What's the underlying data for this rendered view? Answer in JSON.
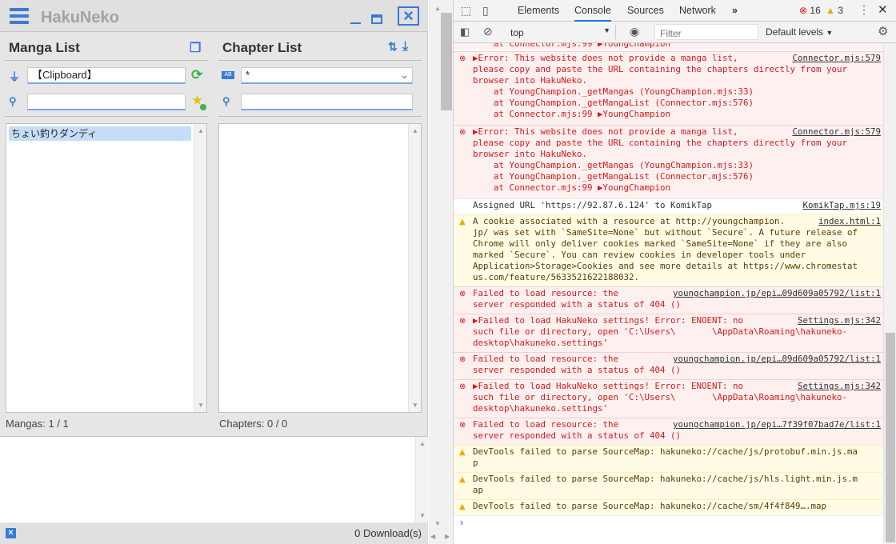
{
  "app": {
    "title": "HakuNeko",
    "manga_list_title": "Manga List",
    "chapter_list_title": "Chapter List",
    "connector_value": "【Clipboard】",
    "language_value": "*",
    "search_value": "",
    "chapter_search_value": "",
    "manga_items": [
      "ちょい釣りダンディ"
    ],
    "manga_count": "Mangas: 1 / 1",
    "chapter_count": "Chapters: 0 / 0",
    "downloads": "0 Download(s)",
    "lang_badge": "AB"
  },
  "devtools": {
    "tabs": [
      "Elements",
      "Console",
      "Sources",
      "Network"
    ],
    "more": "»",
    "errors": "16",
    "warnings": "3",
    "context": "top",
    "filter_placeholder": "Filter",
    "levels": "Default levels",
    "prompt": "›",
    "truncated": "    at Connector.mjs:99 ▶YoungChampion",
    "messages": [
      {
        "type": "err",
        "lines": "▶Error: This website does not provide a manga list,\nplease copy and paste the URL containing the chapters directly from your\nbrowser into HakuNeko.\n    at YoungChampion._getMangas (YoungChampion.mjs:33)\n    at YoungChampion._getMangaList (Connector.mjs:576)\n    at Connector.mjs:99 ▶YoungChampion",
        "src": "Connector.mjs:579"
      },
      {
        "type": "err",
        "lines": "▶Error: This website does not provide a manga list,\nplease copy and paste the URL containing the chapters directly from your\nbrowser into HakuNeko.\n    at YoungChampion._getMangas (YoungChampion.mjs:33)\n    at YoungChampion._getMangaList (Connector.mjs:576)\n    at Connector.mjs:99 ▶YoungChampion",
        "src": "Connector.mjs:579"
      },
      {
        "type": "info",
        "lines": "Assigned URL 'https://92.87.6.124' to KomikTap",
        "src": "KomikTap.mjs:19"
      },
      {
        "type": "warn",
        "lines": "A cookie associated with a resource at http://youngchampion.\njp/ was set with `SameSite=None` but without `Secure`. A future release of\nChrome will only deliver cookies marked `SameSite=None` if they are also\nmarked `Secure`. You can review cookies in developer tools under\nApplication>Storage>Cookies and see more details at https://www.chromestat\nus.com/feature/5633521622188032.",
        "src": "index.html:1"
      },
      {
        "type": "err",
        "lines": "Failed to load resource: the\nserver responded with a status of 404 ()",
        "src": "youngchampion.jp/epi…09d609a05792/list:1"
      },
      {
        "type": "err",
        "lines": "▶Failed to load HakuNeko settings! Error: ENOENT: no\nsuch file or directory, open 'C:\\Users\\       \\AppData\\Roaming\\hakuneko-\ndesktop\\hakuneko.settings'",
        "src": "Settings.mjs:342"
      },
      {
        "type": "err",
        "lines": "Failed to load resource: the\nserver responded with a status of 404 ()",
        "src": "youngchampion.jp/epi…09d609a05792/list:1"
      },
      {
        "type": "err",
        "lines": "▶Failed to load HakuNeko settings! Error: ENOENT: no\nsuch file or directory, open 'C:\\Users\\       \\AppData\\Roaming\\hakuneko-\ndesktop\\hakuneko.settings'",
        "src": "Settings.mjs:342"
      },
      {
        "type": "err",
        "lines": "Failed to load resource: the\nserver responded with a status of 404 ()",
        "src": "youngchampion.jp/epi…7f39f07bad7e/list:1"
      },
      {
        "type": "warn",
        "lines": "DevTools failed to parse SourceMap: hakuneko://cache/js/protobuf.min.js.ma\np",
        "src": ""
      },
      {
        "type": "warn",
        "lines": "DevTools failed to parse SourceMap: hakuneko://cache/js/hls.light.min.js.m\nap",
        "src": ""
      },
      {
        "type": "warn",
        "lines": "DevTools failed to parse SourceMap: hakuneko://cache/sm/4f4f849….map",
        "src": ""
      }
    ]
  }
}
